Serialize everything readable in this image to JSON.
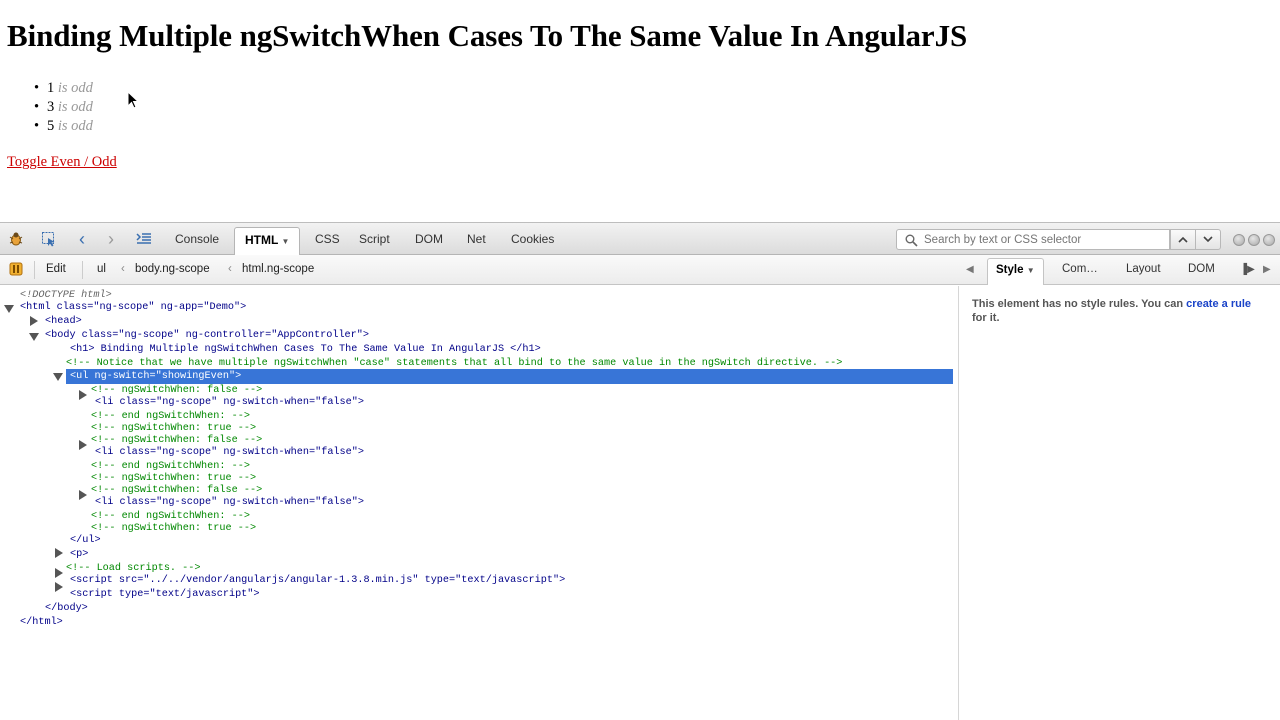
{
  "page": {
    "heading": "Binding Multiple ngSwitchWhen Cases To The Same Value In AngularJS",
    "items": [
      {
        "num": "1",
        "label": "is odd"
      },
      {
        "num": "3",
        "label": "is odd"
      },
      {
        "num": "5",
        "label": "is odd"
      }
    ],
    "toggle_link": "Toggle Even / Odd"
  },
  "firebug": {
    "toolbar": {
      "tabs": [
        "Console",
        "HTML",
        "CSS",
        "Script",
        "DOM",
        "Net",
        "Cookies"
      ],
      "active_tab": "HTML",
      "search_placeholder": "Search by text or CSS selector"
    },
    "subbar": {
      "edit_label": "Edit",
      "breadcrumbs": [
        "ul",
        "body.ng-scope",
        "html.ng-scope"
      ],
      "side_tabs": [
        "Style",
        "Com…",
        "Layout",
        "DOM"
      ],
      "active_side_tab": "Style"
    },
    "side_panel": {
      "message_prefix": "This element has no style rules. You can",
      "link_text": "create a rule",
      "message_suffix": "for it."
    },
    "html_tree": [
      "<!DOCTYPE html>",
      "<html class=\"ng-scope\" ng-app=\"Demo\">",
      "<head>",
      "<body class=\"ng-scope\" ng-controller=\"AppController\">",
      "<h1> Binding Multiple ngSwitchWhen Cases To The Same Value In AngularJS </h1>",
      "<!-- Notice that we have multiple ngSwitchWhen \"case\" statements that all bind to the same value in the ngSwitch directive. -->",
      "<ul ng-switch=\"showingEven\">",
      "<!-- ngSwitchWhen: false -->",
      "<li class=\"ng-scope\" ng-switch-when=\"false\">",
      "<!-- end ngSwitchWhen: -->",
      "<!-- ngSwitchWhen: true -->",
      "<!-- ngSwitchWhen: false -->",
      "<li class=\"ng-scope\" ng-switch-when=\"false\">",
      "<!-- end ngSwitchWhen: -->",
      "<!-- ngSwitchWhen: true -->",
      "<!-- ngSwitchWhen: false -->",
      "<li class=\"ng-scope\" ng-switch-when=\"false\">",
      "<!-- end ngSwitchWhen: -->",
      "<!-- ngSwitchWhen: true -->",
      "</ul>",
      "<p>",
      "<!-- Load scripts. -->",
      "<script src=\"../../vendor/angularjs/angular-1.3.8.min.js\" type=\"text/javascript\">",
      "<script type=\"text/javascript\">",
      "</body>",
      "</html>"
    ]
  }
}
